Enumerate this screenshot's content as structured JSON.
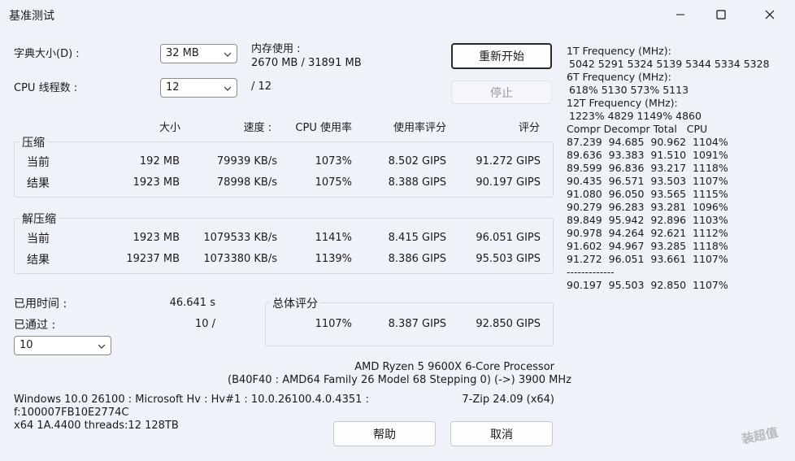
{
  "window": {
    "title": "基准测试"
  },
  "settings": {
    "dict_label": "字典大小(D) :",
    "dict_value": "32 MB",
    "threads_label": "CPU 线程数 :",
    "threads_value": "12",
    "threads_max": "/ 12",
    "mem_label": "内存使用 :",
    "mem_value": "2670 MB / 31891 MB"
  },
  "buttons": {
    "restart": "重新开始",
    "stop": "停止",
    "help": "帮助",
    "cancel": "取消"
  },
  "headers": {
    "size": "大小",
    "speed": "速度 :",
    "cpu_usage": "CPU 使用率",
    "usage_rating": "使用率评分",
    "rating": "评分"
  },
  "compress": {
    "label": "压缩",
    "current": {
      "label": "当前",
      "size": "192 MB",
      "speed": "79939 KB/s",
      "usage": "1073%",
      "urating": "8.502 GIPS",
      "rating": "91.272 GIPS"
    },
    "result": {
      "label": "结果",
      "size": "1923 MB",
      "speed": "78998 KB/s",
      "usage": "1075%",
      "urating": "8.388 GIPS",
      "rating": "90.197 GIPS"
    }
  },
  "decompress": {
    "label": "解压缩",
    "current": {
      "label": "当前",
      "size": "1923 MB",
      "speed": "1079533 KB/s",
      "usage": "1141%",
      "urating": "8.415 GIPS",
      "rating": "96.051 GIPS"
    },
    "result": {
      "label": "结果",
      "size": "19237 MB",
      "speed": "1073380 KB/s",
      "usage": "1139%",
      "urating": "8.386 GIPS",
      "rating": "95.503 GIPS"
    }
  },
  "status": {
    "elapsed_label": "已用时间 :",
    "elapsed_value": "46.641 s",
    "passed_label": "已通过 :",
    "passed_value": "10 /",
    "passes_select": "10"
  },
  "total": {
    "label": "总体评分",
    "usage": "1107%",
    "urating": "8.387 GIPS",
    "rating": "92.850 GIPS"
  },
  "cpu_info": {
    "name": "AMD Ryzen 5 9600X 6-Core Processor",
    "details": "(B40F40 : AMD64 Family 26 Model 68 Stepping 0) (->) 3900 MHz"
  },
  "sys_info": {
    "line1": "Windows 10.0 26100 : Microsoft Hv : Hv#1 : 10.0.26100.4.0.4351 :",
    "line2": "f:100007FB10E2774C",
    "line3": "x64 1A.4400 threads:12 128TB",
    "version": "7-Zip 24.09 (x64)"
  },
  "freq": {
    "f1_label": "1T Frequency (MHz):",
    "f1_values": "5042 5291 5324 5139 5344 5334 5328",
    "f6_label": "6T Frequency (MHz):",
    "f6_values": "618% 5130 573% 5113",
    "f12_label": "12T Frequency (MHz):",
    "f12_values": "1223% 4829 1149% 4860"
  },
  "log": {
    "header": "Compr Decompr Total   CPU",
    "rows": [
      "87.239  94.685  90.962  1104%",
      "89.636  93.383  91.510  1091%",
      "89.599  96.836  93.217  1118%",
      "90.435  96.571  93.503  1107%",
      "91.080  96.050  93.565  1115%",
      "90.279  96.283  93.281  1096%",
      "89.849  95.942  92.896  1103%",
      "90.978  94.264  92.621  1112%",
      "91.602  94.967  93.285  1118%",
      "91.272  96.051  93.661  1107%"
    ],
    "separator": "-------------",
    "summary": "90.197  95.503  92.850  1107%"
  },
  "watermark": "装超值"
}
